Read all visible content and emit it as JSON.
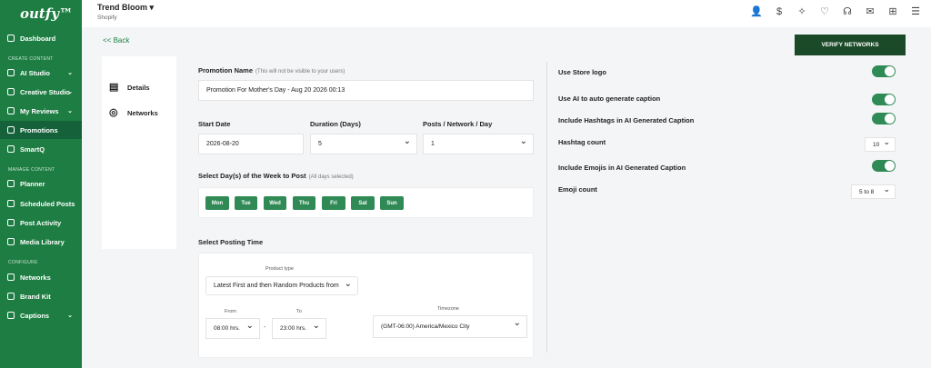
{
  "brand": {
    "logo": "outfy™"
  },
  "sidebar": {
    "sections": [
      "CREATE CONTENT",
      "MANAGE CONTENT",
      "CONFIGURE"
    ],
    "items": [
      {
        "label": "Dashboard",
        "icon": "dashboard-icon"
      },
      {
        "label": "AI Studio",
        "icon": "ai-studio-icon",
        "arrow": "⌄"
      },
      {
        "label": "Creative Studio",
        "icon": "creative-studio-icon",
        "arrow": "⌄"
      },
      {
        "label": "My Reviews",
        "icon": "reviews-icon",
        "arrow": "⌄"
      },
      {
        "label": "Promotions",
        "icon": "promotions-icon",
        "active": true
      },
      {
        "label": "SmartQ",
        "icon": "smartq-icon"
      },
      {
        "label": "Planner",
        "icon": "planner-icon"
      },
      {
        "label": "Scheduled Posts",
        "icon": "scheduled-posts-icon"
      },
      {
        "label": "Post Activity",
        "icon": "post-activity-icon"
      },
      {
        "label": "Media Library",
        "icon": "media-library-icon"
      },
      {
        "label": "Networks",
        "icon": "networks-icon"
      },
      {
        "label": "Brand Kit",
        "icon": "brand-kit-icon"
      },
      {
        "label": "Captions",
        "icon": "captions-icon",
        "arrow": "⌄"
      }
    ]
  },
  "topbar": {
    "store_name": "Trend Bloom",
    "store_caret": "▾",
    "store_platform": "Shopify",
    "icons": [
      "user-icon",
      "billing-icon",
      "magic-icon",
      "handshake-icon",
      "support-icon",
      "notifications-icon",
      "grid-icon",
      "menu-icon"
    ]
  },
  "back_label": "<< Back",
  "verify_label": "VERIFY NETWORKS",
  "left_panel": {
    "items": [
      {
        "label": "Details",
        "icon": "details-icon"
      },
      {
        "label": "Networks",
        "icon": "globe-icon"
      }
    ]
  },
  "form": {
    "promotion_name_label": "Promotion Name",
    "promotion_name_hint": "(This will not be visible to your users)",
    "promotion_name_value": "Promotion For Mother's Day - Aug 20 2026 00:13",
    "start_date_label": "Start Date",
    "start_date_value": "2026-08-20",
    "duration_label": "Duration (Days)",
    "duration_value": "5",
    "posts_label": "Posts / Network / Day",
    "posts_value": "1",
    "days_label": "Select Day(s) of the Week to Post",
    "days_hint": "(All days selected)",
    "days": [
      "Mon",
      "Tue",
      "Wed",
      "Thu",
      "Fri",
      "Sat",
      "Sun"
    ],
    "posting_time_label": "Select Posting Time",
    "product_type_label": "Product type",
    "product_type_value": "Latest First and then Random Products from",
    "from_label": "From",
    "from_value": "08:00 hrs.",
    "to_label": "To",
    "to_value": "23:00 hrs.",
    "range_sep": "-",
    "timezone_label": "Timezone",
    "timezone_value": "(GMT-06:00) America/Mexico City"
  },
  "settings": {
    "use_store_logo": "Use Store logo",
    "ai_caption": "Use AI to auto generate caption",
    "hashtags": "Include Hashtags in AI Generated Caption",
    "hashtag_count_label": "Hashtag count",
    "hashtag_count_value": "10",
    "emojis": "Include Emojis in AI Generated Caption",
    "emoji_count_label": "Emoji count",
    "emoji_count_value": "5 to 8"
  },
  "colors": {
    "primary": "#1d7d42",
    "dark": "#1b4a28",
    "day_btn": "#2f8a55"
  }
}
